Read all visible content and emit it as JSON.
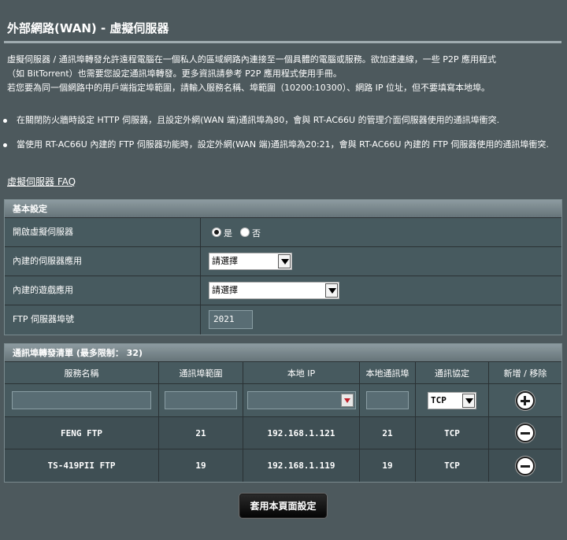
{
  "page": {
    "title": "外部網路(WAN) - 虛擬伺服器",
    "description": [
      "虛擬伺服器 / 通訊埠轉發允許遠程電腦在一個私人的區域網路內連接至一個具體的電腦或服務。欲加速連線，一些 P2P 應用程式",
      "（如 BitTorrent）也需要您設定通訊埠轉發。更多資訊請參考 P2P 應用程式使用手冊。",
      "若您要為同一個網路中的用戶端指定埠範圍，請輸入服務名稱、埠範圍（10200:10300）、網路 IP 位址，但不要填寫本地埠。"
    ],
    "notes": [
      "在關閉防火牆時設定 HTTP 伺服器，且設定外網(WAN 端)通訊埠為80，會與 RT-AC66U 的管理介面伺服器使用的通訊埠衝突.",
      "當使用 RT-AC66U 內建的 FTP 伺服器功能時，設定外網(WAN 端)通訊埠為20:21，會與 RT-AC66U 內建的 FTP 伺服器使用的通訊埠衝突."
    ],
    "faq_link": "虛擬伺服器 FAQ"
  },
  "basic": {
    "header": "基本設定",
    "enable_label": "開啟虛擬伺服器",
    "enable_yes": "是",
    "enable_no": "否",
    "enabled": true,
    "server_app_label": "內建的伺服器應用",
    "server_app_value": "請選擇",
    "game_app_label": "內建的遊戲應用",
    "game_app_value": "請選擇",
    "ftp_port_label": "FTP 伺服器埠號",
    "ftp_port_value": "2021"
  },
  "forward_list": {
    "header": "通訊埠轉發清單 (最多限制： 32)",
    "columns": [
      "服務名稱",
      "通訊埠範圍",
      "本地 IP",
      "本地通訊埠",
      "通訊協定",
      "新增 / 移除"
    ],
    "new_protocol": "TCP",
    "rows": [
      {
        "name": "FENG FTP",
        "port_range": "21",
        "local_ip": "192.168.1.121",
        "local_port": "21",
        "protocol": "TCP"
      },
      {
        "name": "TS-419PII FTP",
        "port_range": "19",
        "local_ip": "192.168.1.119",
        "local_port": "19",
        "protocol": "TCP"
      }
    ]
  },
  "apply_label": "套用本頁面設定",
  "icons": {
    "add": "plus-circle-icon",
    "remove": "minus-circle-icon"
  },
  "colors": {
    "background": "#4d595d",
    "row": "#475a5f",
    "header": "#7a888d"
  }
}
